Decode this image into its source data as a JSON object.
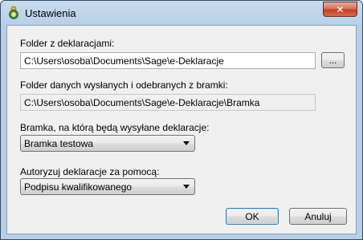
{
  "window": {
    "title": "Ustawienia",
    "close_label": "✕"
  },
  "form": {
    "declarations_folder": {
      "label": "Folder z deklaracjami:",
      "value": "C:\\Users\\osoba\\Documents\\Sage\\e-Deklaracje",
      "browse_label": "..."
    },
    "gateway_folder": {
      "label": "Folder danych wysłanych i odebranych z bramki:",
      "value": "C:\\Users\\osoba\\Documents\\Sage\\e-Deklaracje\\Bramka"
    },
    "gateway": {
      "label": "Bramka, na którą będą wysyłane deklaracje:",
      "selected": "Bramka testowa"
    },
    "authorization": {
      "label": "Autoryzuj deklaracje za pomocą:",
      "selected": "Podpisu kwalifikowanego"
    }
  },
  "buttons": {
    "ok": "OK",
    "cancel": "Anuluj"
  },
  "colors": {
    "title_bar": "#b7cfe8",
    "close_button": "#c13f28",
    "dialog_bg": "#f0f0f0"
  }
}
